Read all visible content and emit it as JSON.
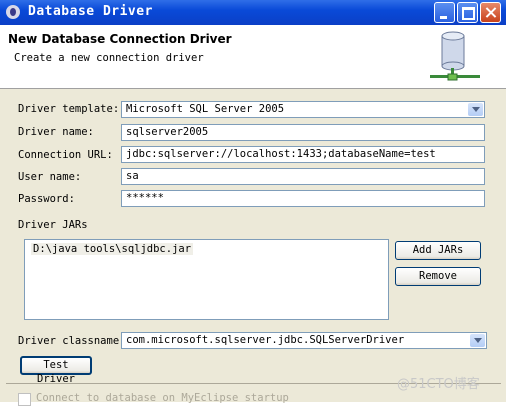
{
  "window": {
    "title": "Database Driver"
  },
  "banner": {
    "title": "New Database Connection Driver",
    "subtitle": "Create a new connection driver"
  },
  "form": {
    "driver_template": {
      "label": "Driver template:",
      "value": "Microsoft SQL Server 2005"
    },
    "driver_name": {
      "label": "Driver name:",
      "value": "sqlserver2005"
    },
    "connection_url": {
      "label": "Connection URL:",
      "value": "jdbc:sqlserver://localhost:1433;databaseName=test"
    },
    "user_name": {
      "label": "User name:",
      "value": "sa"
    },
    "password": {
      "label": "Password:",
      "value": "******"
    },
    "driver_jars": {
      "label": "Driver JARs",
      "items": [
        "D:\\java tools\\sqljdbc.jar"
      ],
      "add_label": "Add JARs",
      "remove_label": "Remove"
    },
    "driver_classname": {
      "label": "Driver classname:",
      "value": "com.microsoft.sqlserver.jdbc.SQLServerDriver"
    },
    "test_button": "Test Driver",
    "startup_checkbox": "Connect to database on MyEclipse startup"
  },
  "watermark": "@51CTO博客"
}
